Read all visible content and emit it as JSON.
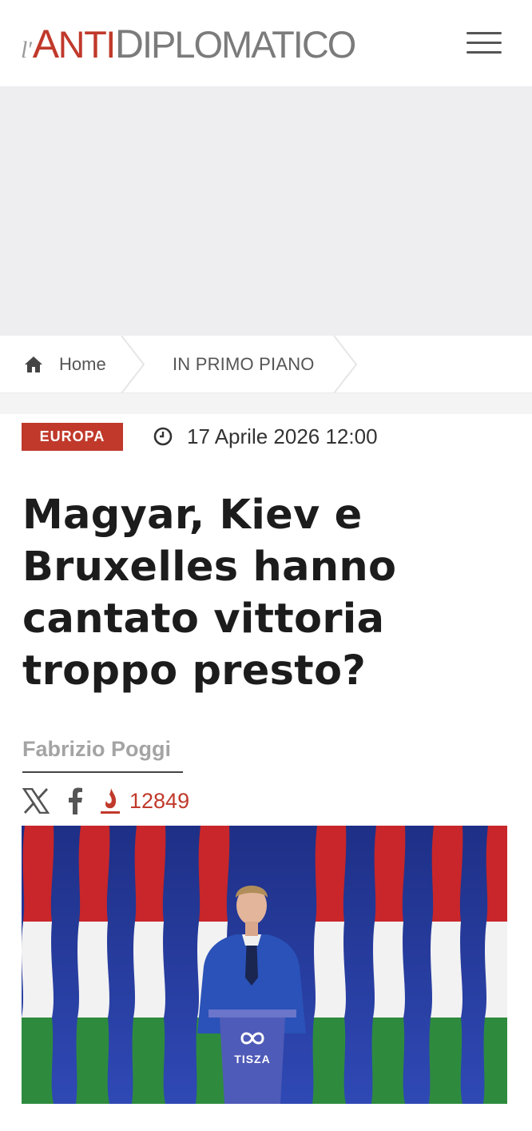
{
  "header": {
    "logo_prefix": "l'",
    "logo_anti_cap": "A",
    "logo_anti_rest": "NTI",
    "logo_dipl_cap": "D",
    "logo_dipl_rest": "IPLOMATICO",
    "menu_icon": "hamburger-menu-icon"
  },
  "breadcrumb": {
    "home_icon": "home-icon",
    "home_label": "Home",
    "section_label": "IN PRIMO PIANO"
  },
  "article": {
    "category": "EUROPA",
    "date_icon": "clock-icon",
    "date": "17 Aprile 2026 12:00",
    "title": "Magyar, Kiev e Bruxelles hanno cantato vittoria troppo presto?",
    "author": "Fabrizio Poggi",
    "share": {
      "x_icon": "x-icon",
      "facebook_icon": "facebook-icon",
      "views_icon": "fire-icon",
      "views_count": "12849"
    },
    "image": {
      "podium_text": "TISZA"
    }
  },
  "colors": {
    "accent": "#c0392b",
    "logo_gray": "#7b7b7b",
    "ad_background": "#eeeef0",
    "flag_red": "#c8262a",
    "flag_white": "#f2f2f2",
    "flag_green": "#2e8b3e",
    "backdrop_blue": "#1e2f86"
  }
}
